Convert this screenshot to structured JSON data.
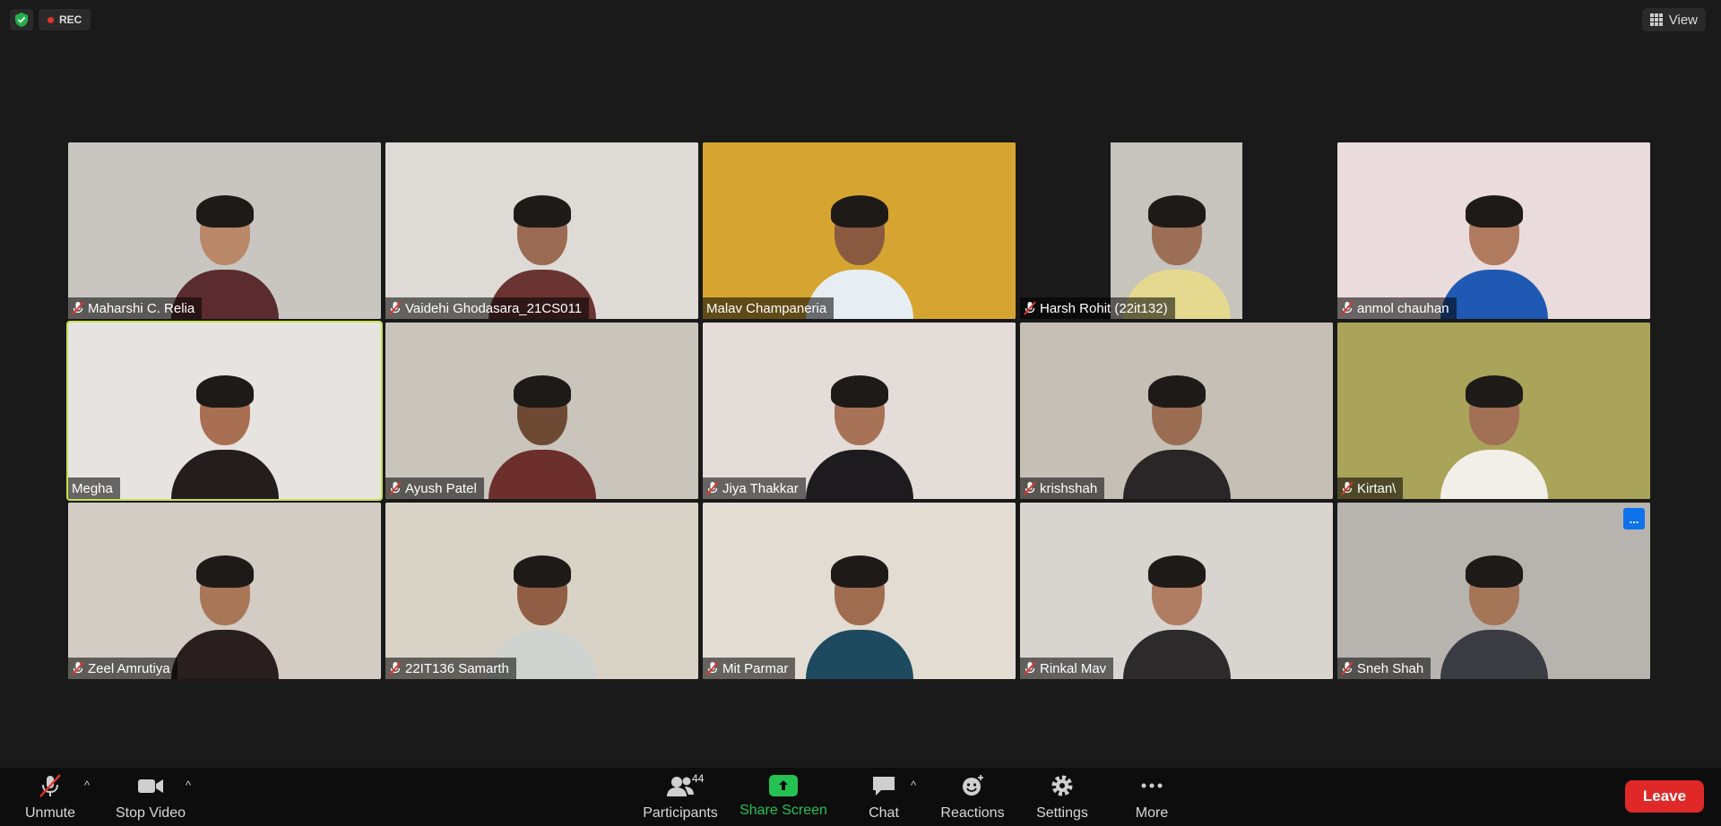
{
  "top": {
    "rec_label": "REC",
    "view_label": "View"
  },
  "participants": [
    {
      "name": "Maharshi C. Relia",
      "muted": true,
      "bg": "#c9c6c2",
      "shirt": "#5a2b2f",
      "skin": "#b88868"
    },
    {
      "name": "Vaidehi Ghodasara_21CS011",
      "muted": true,
      "bg": "#dedbd6",
      "shirt": "#6a3433",
      "skin": "#9a6a52"
    },
    {
      "name": "Malav Champaneria",
      "muted": false,
      "bg": "#d6a531",
      "shirt": "#e6eef3",
      "skin": "#8a5a40"
    },
    {
      "name": "Harsh Rohit (22it132)",
      "muted": true,
      "bg": "#c7c3bd",
      "shirt": "#e4d98e",
      "skin": "#9b6e55",
      "narrow": true
    },
    {
      "name": "anmol chauhan",
      "muted": true,
      "bg": "#eadcdc",
      "shirt": "#1f59b3",
      "skin": "#b07a5e"
    },
    {
      "name": "Megha",
      "muted": false,
      "bg": "#e7e3e1",
      "shirt": "#231d1d",
      "skin": "#a96f52",
      "active": true
    },
    {
      "name": "Ayush Patel",
      "muted": true,
      "bg": "#c9c5bd",
      "shirt": "#6d2f2c",
      "skin": "#6e4a34"
    },
    {
      "name": "Jiya Thakkar",
      "muted": true,
      "bg": "#e3dcd9",
      "shirt": "#1e1b1e",
      "skin": "#a87257"
    },
    {
      "name": "krishshah",
      "muted": true,
      "bg": "#c6bfb6",
      "shirt": "#2a2627",
      "skin": "#9a6d53"
    },
    {
      "name": "Kirtan\\",
      "muted": true,
      "bg": "#aaa35a",
      "shirt": "#f2efe9",
      "skin": "#a27054"
    },
    {
      "name": "Zeel Amrutiya",
      "muted": true,
      "bg": "#d2ccc4",
      "shirt": "#2a1f1f",
      "skin": "#a97657"
    },
    {
      "name": "22IT136 Samarth",
      "muted": true,
      "bg": "#d9d3c7",
      "shirt": "#cfd3cf",
      "skin": "#8f5e44"
    },
    {
      "name": "Mit Parmar",
      "muted": true,
      "bg": "#e2dcd3",
      "shirt": "#1d4a5e",
      "skin": "#a06c50"
    },
    {
      "name": "Rinkal Mav",
      "muted": true,
      "bg": "#d8d4cf",
      "shirt": "#2d2a2c",
      "skin": "#b07c62"
    },
    {
      "name": "Sneh Shah",
      "muted": true,
      "bg": "#b7b4b0",
      "shirt": "#3a3b43",
      "skin": "#a57558",
      "more": true
    }
  ],
  "toolbar": {
    "unmute": "Unmute",
    "stop_video": "Stop Video",
    "participants": "Participants",
    "participants_count": "44",
    "share_screen": "Share Screen",
    "chat": "Chat",
    "reactions": "Reactions",
    "settings": "Settings",
    "more": "More",
    "leave": "Leave",
    "tile_more": "..."
  },
  "colors": {
    "active_speaker": "#c8e04a",
    "share_green": "#25c152",
    "leave_red": "#e02828",
    "rec_red": "#e0352b"
  }
}
